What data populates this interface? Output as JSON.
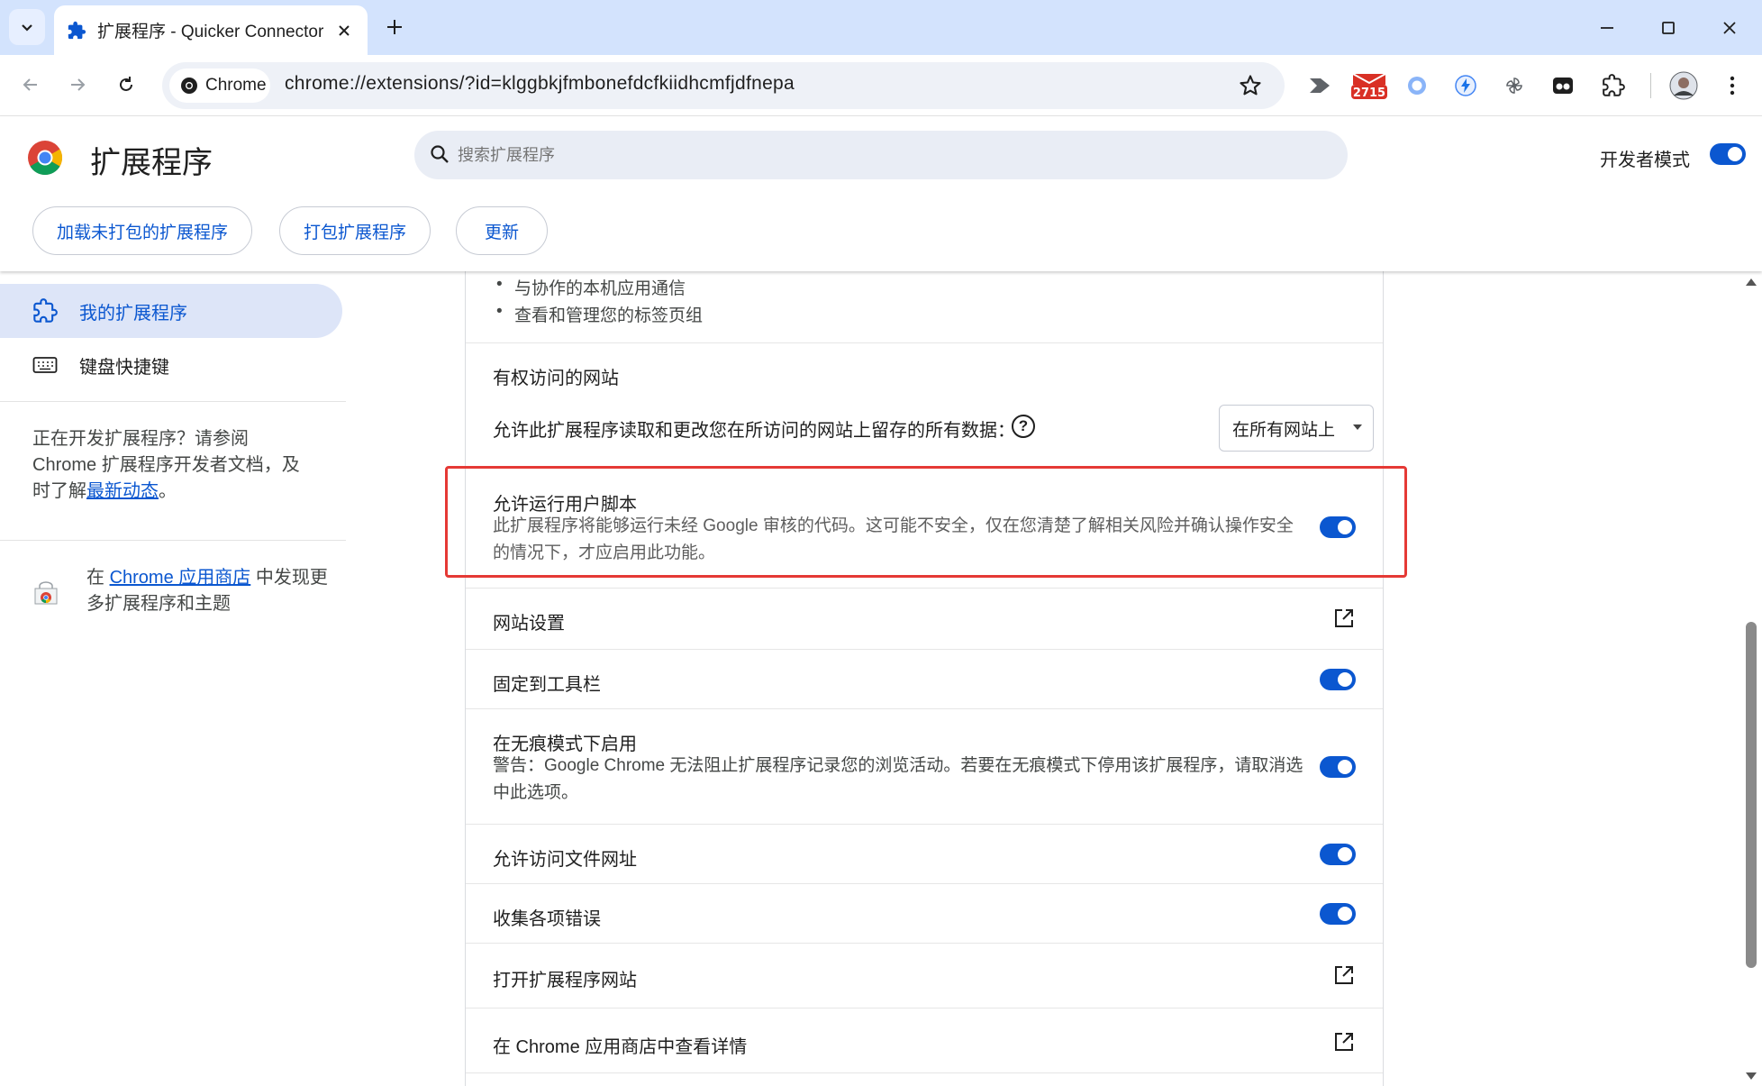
{
  "browser": {
    "tab_title": "扩展程序 - Quicker Connector",
    "omnibox_chip": "Chrome",
    "url": "chrome://extensions/?id=klggbkjfmbonefdcfkiidhcmfjdfnepa",
    "badge_count": "2715"
  },
  "header": {
    "title": "扩展程序",
    "search_placeholder": "搜索扩展程序",
    "dev_mode_label": "开发者模式",
    "dev_mode_on": true,
    "buttons": {
      "load_unpacked": "加载未打包的扩展程序",
      "pack": "打包扩展程序",
      "update": "更新"
    }
  },
  "sidebar": {
    "items": [
      {
        "label": "我的扩展程序",
        "active": true
      },
      {
        "label": "键盘快捷键",
        "active": false
      }
    ],
    "dev_text_before": "正在开发扩展程序？请参阅 Chrome 扩展程序开发者文档，及时了解",
    "dev_link": "最新动态",
    "dev_text_after": "。",
    "store_prefix": "在 ",
    "store_link": "Chrome 应用商店",
    "store_suffix": " 中发现更多扩展程序和主题"
  },
  "details": {
    "permissions": [
      "与协作的本机应用通信",
      "查看和管理您的标签页组"
    ],
    "site_access_title": "有权访问的网站",
    "site_access_desc": "允许此扩展程序读取和更改您在所访问的网站上留存的所有数据：",
    "site_access_value": "在所有网站上",
    "user_scripts_title": "允许运行用户脚本",
    "user_scripts_desc": "此扩展程序将能够运行未经 Google 审核的代码。这可能不安全，仅在您清楚了解相关风险并确认操作安全的情况下，才应启用此功能。",
    "site_settings": "网站设置",
    "pin_toolbar": "固定到工具栏",
    "incognito_title": "在无痕模式下启用",
    "incognito_desc": "警告：Google Chrome 无法阻止扩展程序记录您的浏览活动。若要在无痕模式下停用该扩展程序，请取消选中此选项。",
    "file_urls": "允许访问文件网址",
    "collect_errors": "收集各项错误",
    "open_site": "打开扩展程序网站",
    "view_in_store": "在 Chrome 应用商店中查看详情"
  },
  "colors": {
    "accent": "#0b57d0",
    "tabstrip": "#d3e3fd",
    "highlight": "#e53935"
  }
}
